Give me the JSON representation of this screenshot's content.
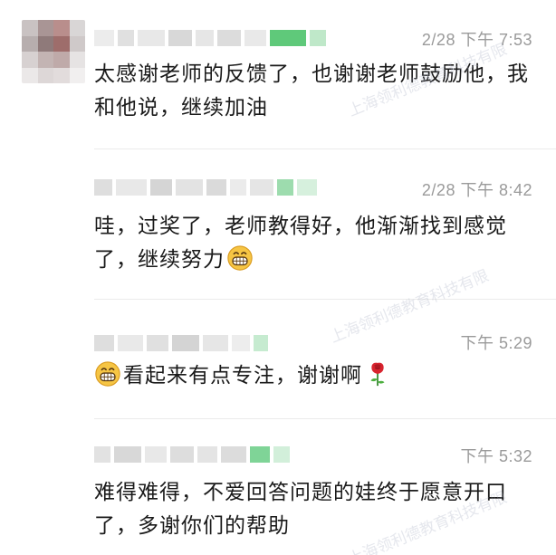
{
  "comments": [
    {
      "time": "2/28  下午 7:53",
      "text": "太感谢老师的反馈了，也谢谢老师鼓励他，我和他说，继续加油"
    },
    {
      "time": "2/28  下午 8:42",
      "text": "哇，过奖了，老师教得好，他渐渐找到感觉了，继续努力",
      "emoji": "grinning-face-icon"
    },
    {
      "time": "下午 5:29",
      "text": "看起来有点专注，谢谢啊",
      "emoji_before": "grinning-face-icon",
      "emoji_after": "rose-icon"
    },
    {
      "time": "下午 5:32",
      "text": "难得难得，不爱回答问题的娃终于愿意开口了，多谢你们的帮助"
    }
  ],
  "watermark": "上海领利德教育科技有限",
  "colors": {
    "text": "#1a1a1a",
    "timestamp": "#9a9a9a",
    "divider": "#ebebeb",
    "blur_green": "#5fc97a"
  }
}
